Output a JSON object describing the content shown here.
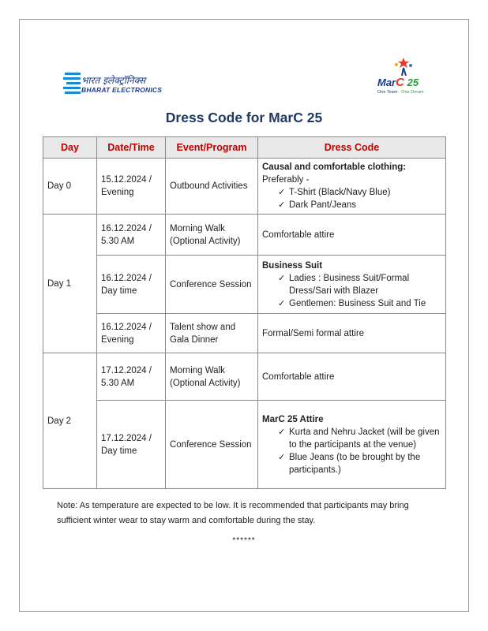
{
  "logos": {
    "left_hindi": "भारत इलेक्ट्रॉनिक्स",
    "left_english": "BHARAT ELECTRONICS",
    "right_brand_a": "Mar",
    "right_brand_c": "C",
    "right_brand_num": "25",
    "right_tag_a": "One Team · ",
    "right_tag_b": "One Dream"
  },
  "title": "Dress Code for MarC 25",
  "table": {
    "headers": [
      "Day",
      "Date/Time",
      "Event/Program",
      "Dress Code"
    ],
    "day0": {
      "day": "Day 0",
      "date": "15.12.2024 / Evening",
      "event": "Outbound Activities",
      "code_title": "Causal and comfortable clothing:",
      "code_sub": "Preferably -",
      "items": [
        "T-Shirt (Black/Navy Blue)",
        "Dark Pant/Jeans"
      ]
    },
    "day1": {
      "day": "Day 1",
      "rows": [
        {
          "date": "16.12.2024 / 5.30 AM",
          "event": "Morning Walk (Optional Activity)",
          "code": "Comfortable attire"
        },
        {
          "date": "16.12.2024 / Day time",
          "event": "Conference Session",
          "code_title": "Business Suit",
          "items": [
            "Ladies : Business Suit/Formal Dress/Sari with Blazer",
            "Gentlemen: Business Suit and Tie"
          ]
        },
        {
          "date": "16.12.2024 / Evening",
          "event": "Talent show and Gala Dinner",
          "code": "Formal/Semi formal attire"
        }
      ]
    },
    "day2": {
      "day": "Day 2",
      "rows": [
        {
          "date": "17.12.2024 / 5.30 AM",
          "event": "Morning Walk (Optional Activity)",
          "code": "Comfortable attire"
        },
        {
          "date": "17.12.2024 / Day time",
          "event": "Conference Session",
          "code_title": "MarC 25 Attire",
          "items": [
            "Kurta and Nehru Jacket (will be given to the participants at the venue)",
            "Blue Jeans (to be brought by the participants.)"
          ]
        }
      ]
    }
  },
  "tick": "✓",
  "note": "Note: As temperature are expected to be low. It is recommended that participants may bring sufficient winter wear to stay warm and comfortable during the stay.",
  "end_marker": "******"
}
